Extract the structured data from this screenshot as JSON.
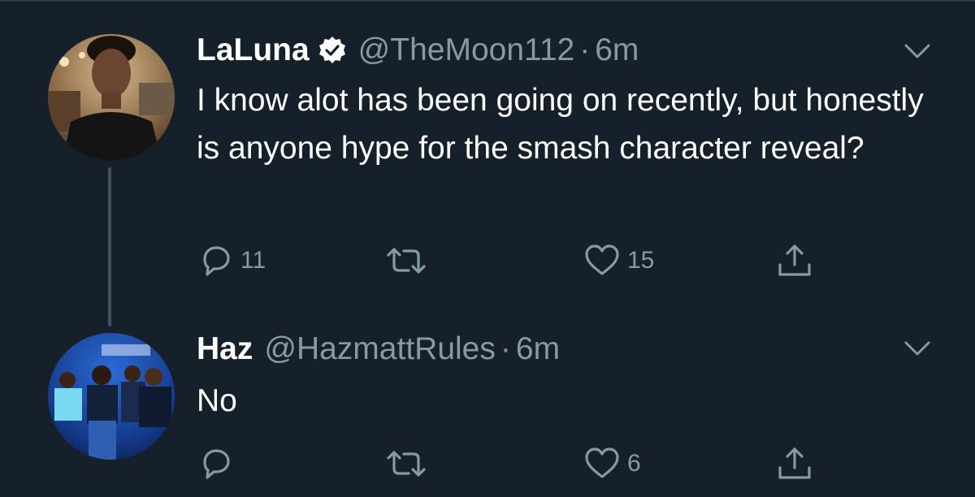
{
  "tweets": [
    {
      "author_name": "LaLuna",
      "verified": true,
      "handle": "@TheMoon112",
      "separator": "·",
      "time": "6m",
      "text": "I know alot has been going on recently, but honestly is anyone hype for the smash character reveal?",
      "reply_count": "11",
      "retweet_count": "",
      "like_count": "15"
    },
    {
      "author_name": "Haz",
      "verified": false,
      "handle": "@HazmattRules",
      "separator": "·",
      "time": "6m",
      "text": "No",
      "reply_count": "",
      "retweet_count": "",
      "like_count": "6"
    }
  ],
  "icons": {
    "reply": "speech-bubble-icon",
    "retweet": "retweet-arrows-icon",
    "like": "heart-icon",
    "share": "share-upload-icon",
    "menu": "chevron-down-icon",
    "verified": "verified-badge-icon"
  },
  "colors": {
    "background": "#15202b",
    "text_primary": "#ffffff",
    "text_secondary": "#8899a6",
    "thread_line": "#3d5466"
  }
}
